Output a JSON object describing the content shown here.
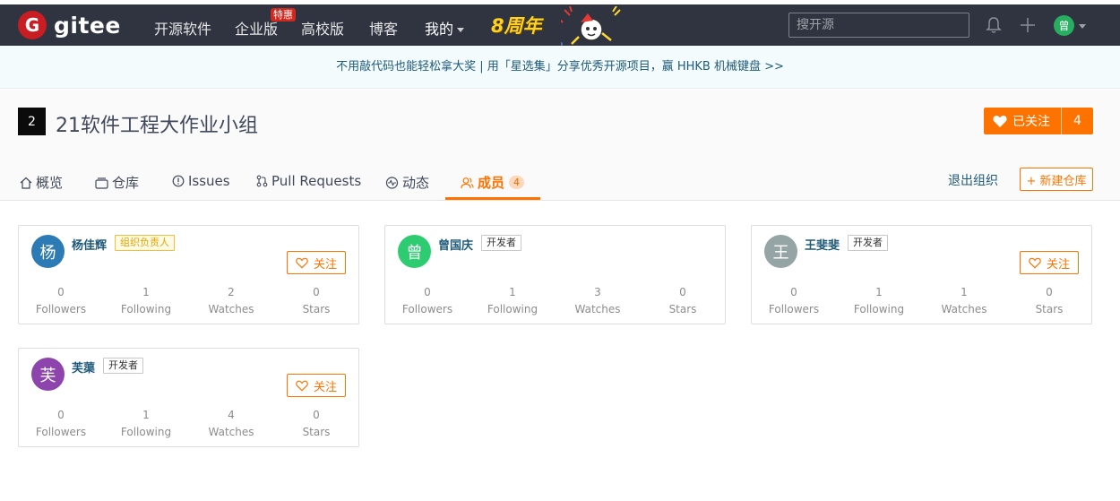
{
  "navbar": {
    "logo_mark": "G",
    "logo_text": "gitee",
    "items": [
      {
        "label": "开源软件"
      },
      {
        "label": "企业版"
      },
      {
        "label": "高校版"
      },
      {
        "label": "博客"
      },
      {
        "label": "我的"
      }
    ],
    "hot_badge": "特惠",
    "anniversary_text": "8周年",
    "search_placeholder": "搜开源",
    "user_avatar": "曾"
  },
  "banner": {
    "text": "不用敲代码也能轻松拿大奖 | 用「星选集」分享优秀开源项目，赢 HHKB 机械键盘 >>"
  },
  "org": {
    "badge": "2",
    "title": "21软件工程大作业小组",
    "follow_label": "已关注",
    "follow_count": "4",
    "exit_label": "退出组织",
    "new_repo_label": "+ 新建仓库"
  },
  "tabs": [
    {
      "label": "概览"
    },
    {
      "label": "仓库"
    },
    {
      "label": "Issues"
    },
    {
      "label": "Pull Requests"
    },
    {
      "label": "动态"
    },
    {
      "label": "成员",
      "count": "4"
    }
  ],
  "stat_labels": [
    "Followers",
    "Following",
    "Watches",
    "Stars"
  ],
  "follow_button_label": "关注",
  "colors": {
    "accent": "#fe7300",
    "navbar_bg": "#2f3440",
    "link": "#1e5a7a"
  },
  "members": [
    {
      "avatar": "杨",
      "avatar_color": "#2d7bb5",
      "name": "杨佳辉",
      "role": "组织负责人",
      "show_follow": true,
      "stats": [
        "0",
        "1",
        "2",
        "0"
      ]
    },
    {
      "avatar": "曾",
      "avatar_color": "#2ecc71",
      "name": "曾国庆",
      "role": "开发者",
      "show_follow": false,
      "stats": [
        "0",
        "1",
        "3",
        "0"
      ]
    },
    {
      "avatar": "王",
      "avatar_color": "#95a5a6",
      "name": "王斐斐",
      "role": "开发者",
      "show_follow": true,
      "stats": [
        "0",
        "1",
        "1",
        "0"
      ]
    },
    {
      "avatar": "芙",
      "avatar_color": "#8e44ad",
      "name": "芙蕖",
      "role": "开发者",
      "show_follow": true,
      "stats": [
        "0",
        "1",
        "4",
        "0"
      ]
    }
  ]
}
